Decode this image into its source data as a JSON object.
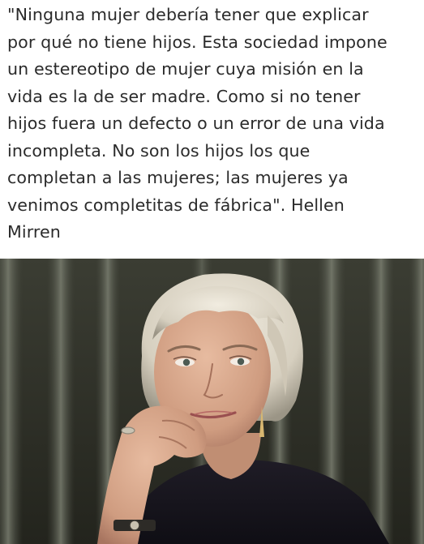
{
  "quote": {
    "lines": [
      "\"Ninguna mujer debería tener que explicar",
      "por qué no tiene hijos. Esta sociedad impone",
      "un estereotipo de mujer cuya misión en la",
      "vida es la de ser madre. Como si no tener",
      "hijos fuera un defecto o un error de una vida",
      "incompleta. No son los hijos los que",
      "completan a las mujeres; las mujeres ya",
      "venimos completitas de fábrica\". Hellen",
      "Mirren"
    ]
  },
  "photo": {
    "subject": "portrait-photo",
    "colors": {
      "background_dark": "#2a2b22",
      "background_stripe": "#6a6e62",
      "hair": "#e2dccd",
      "skin": "#d4a48a",
      "sweater": "#16141c"
    }
  }
}
